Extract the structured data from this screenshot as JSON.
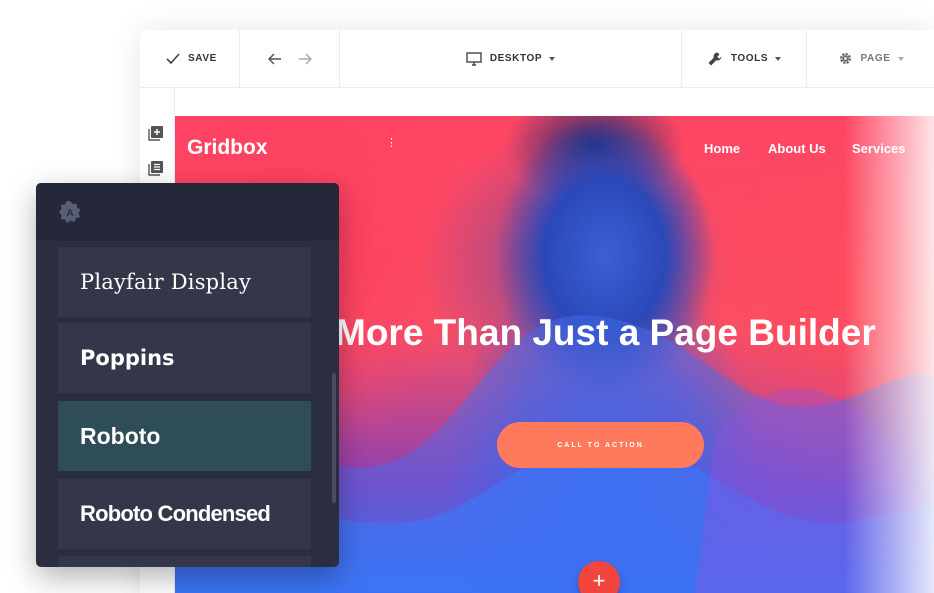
{
  "toolbar": {
    "save_label": "SAVE",
    "device_label": "DESKTOP",
    "tools_label": "TOOLS",
    "page_label": "PAGE"
  },
  "sidebar": {
    "icons": [
      "add-section-icon",
      "layers-icon"
    ]
  },
  "canvas": {
    "brand": "Gridbox",
    "nav": [
      "Home",
      "About Us",
      "Services"
    ],
    "headline": "More Than Just a Page Builder",
    "cta_label": "CALL TO ACTION",
    "fab_label": "+"
  },
  "font_panel": {
    "logo_letter": "A",
    "fonts": [
      "Playfair Display",
      "Poppins",
      "Roboto",
      "Roboto Condensed"
    ],
    "selected": "Roboto"
  },
  "colors": {
    "accent_cta": "#ff7a5c",
    "fab": "#f1453d",
    "panel_bg": "#2b2e40",
    "panel_item": "#343749",
    "panel_selected": "#2f4d56"
  }
}
